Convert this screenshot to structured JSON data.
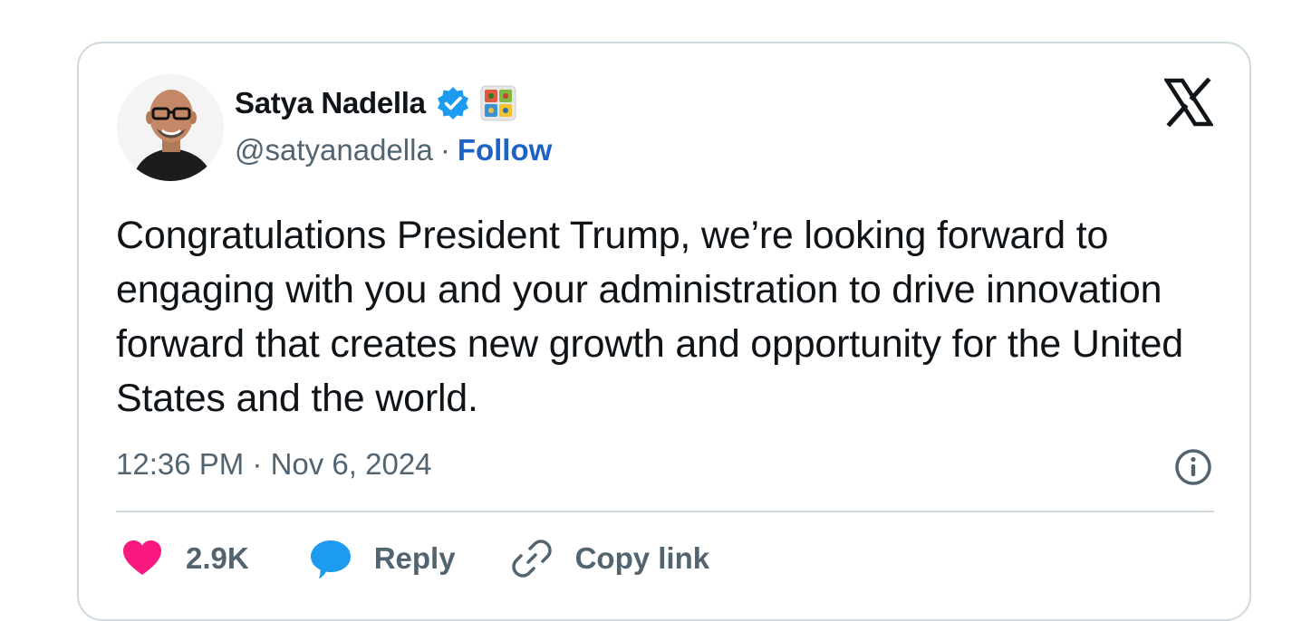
{
  "author": {
    "name": "Satya Nadella",
    "handle": "@satyanadella",
    "separator": "·",
    "follow_label": "Follow"
  },
  "tweet": {
    "text": "Congratulations President Trump, we’re looking forward to engaging with you and your administration to drive innovation forward that creates new growth and opportunity for the United States and the world.",
    "timestamp": "12:36 PM · Nov 6, 2024"
  },
  "actions": {
    "likes_count": "2.9K",
    "reply_label": "Reply",
    "copy_link_label": "Copy link"
  },
  "icons": {
    "verified": "verified-badge-icon",
    "affiliate": "microsoft-affiliate-icon",
    "platform": "x-logo-icon",
    "info": "info-icon",
    "like": "heart-icon",
    "reply": "speech-bubble-icon",
    "copy_link": "link-icon"
  },
  "colors": {
    "text": "#0f1419",
    "secondary": "#536471",
    "follow": "#1d62c8",
    "verified": "#1d9bf0",
    "heart": "#f91880",
    "reply_bubble": "#1d9bf0",
    "border": "#cfd9de"
  }
}
